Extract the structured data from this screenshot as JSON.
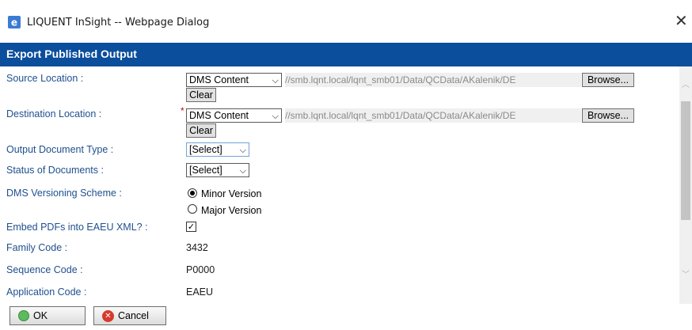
{
  "window": {
    "title": "LIQUENT InSight -- Webpage Dialog",
    "close_glyph": "✕",
    "icon": "ie-icon"
  },
  "header": {
    "title": "Export Published Output"
  },
  "form": {
    "source_location": {
      "label": "Source Location :",
      "select_value": "DMS Content",
      "path": "//smb.lqnt.local/lqnt_smb01/Data/QCData/AKalenik/DE",
      "browse_label": "Browse...",
      "clear_label": "Clear"
    },
    "destination_location": {
      "label": "Destination Location :",
      "required_marker": "*",
      "select_value": "DMS Content",
      "path": "//smb.lqnt.local/lqnt_smb01/Data/QCData/AKalenik/DE",
      "browse_label": "Browse...",
      "clear_label": "Clear"
    },
    "output_document_type": {
      "label": "Output Document Type :",
      "select_value": "[Select]"
    },
    "status_of_documents": {
      "label": "Status of Documents :",
      "select_value": "[Select]"
    },
    "dms_versioning_scheme": {
      "label": "DMS Versioning Scheme :",
      "options": [
        "Minor Version",
        "Major Version"
      ],
      "selected": "Minor Version"
    },
    "embed_pdfs": {
      "label": "Embed PDFs into EAEU XML? :",
      "checked": true,
      "check_glyph": "✓"
    },
    "family_code": {
      "label": "Family Code :",
      "value": "3432"
    },
    "sequence_code": {
      "label": "Sequence Code :",
      "value": "P0000"
    },
    "application_code": {
      "label": "Application Code :",
      "value": "EAEU"
    }
  },
  "footer": {
    "ok_label": "OK",
    "cancel_label": "Cancel"
  },
  "colors": {
    "header_bg": "#0a4e9c",
    "label_text": "#1f4f8f",
    "required": "#d40000"
  }
}
